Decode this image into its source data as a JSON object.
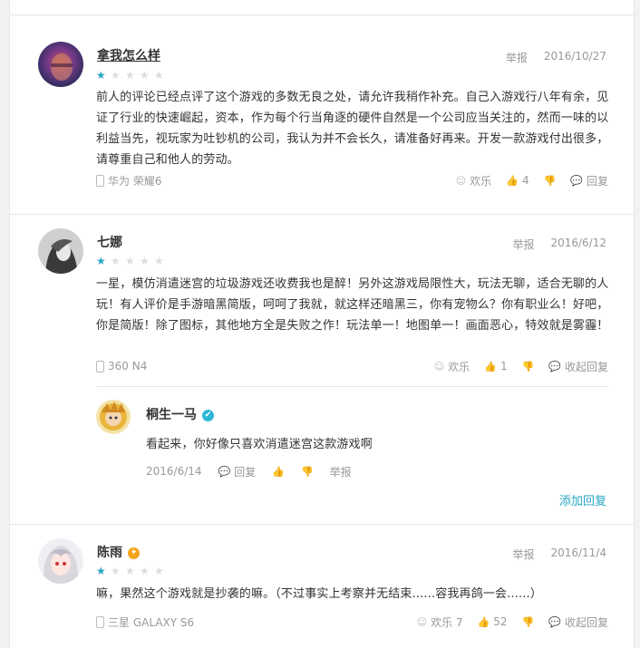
{
  "reviews": [
    {
      "username": "拿我怎么样",
      "rating": 1,
      "report": "举报",
      "date": "2016/10/27",
      "content": "前人的评论已经点评了这个游戏的多数无良之处，请允许我稍作补充。自己入游戏行八年有余，见证了行业的快速崛起，资本，作为每个行当角逐的硬件自然是一个公司应当关注的，然而一味的以利益当先，视玩家为吐钞机的公司，我认为并不会长久，请准备好再来。开发一款游戏付出很多，请尊重自己和他人的劳动。",
      "device": "华为 荣耀6",
      "funny": "欢乐",
      "likes": "4",
      "reply_label": "回复"
    },
    {
      "username": "七娜",
      "rating": 1,
      "report": "举报",
      "date": "2016/6/12",
      "content": "一星，模仿消遣迷宫的垃圾游戏还收费我也是醉！另外这游戏局限性大，玩法无聊，适合无聊的人玩！有人评价是手游暗黑简版，呵呵了我就，就这样还暗黑三，你有宠物么？你有职业么！好吧，你是简版！除了图标，其他地方全是失败之作！玩法单一！地图单一！画面恶心，特效就是雾霾！",
      "device": "360 N4",
      "funny": "欢乐",
      "likes": "1",
      "reply_label": "收起回复",
      "reply": {
        "username": "桐生一马",
        "content": "看起来，你好像只喜欢消遣迷宫这款游戏啊",
        "date": "2016/6/14",
        "reply_label": "回复",
        "report": "举报"
      },
      "add_reply": "添加回复"
    },
    {
      "username": "陈雨",
      "rating": 1,
      "report": "举报",
      "date": "2016/11/4",
      "content": "嘛，果然这个游戏就是抄袭的嘛。（不过事实上考察并无结束......容我再鸽一会......）",
      "device": "三星 GALAXY S6",
      "funny": "欢乐 7",
      "likes": "52",
      "reply_label": "收起回复"
    }
  ],
  "colors": {
    "accent": "#26a6c3",
    "star_off": "#dddddd",
    "verified": "#2db7d6",
    "vip": "#f7a41d"
  }
}
